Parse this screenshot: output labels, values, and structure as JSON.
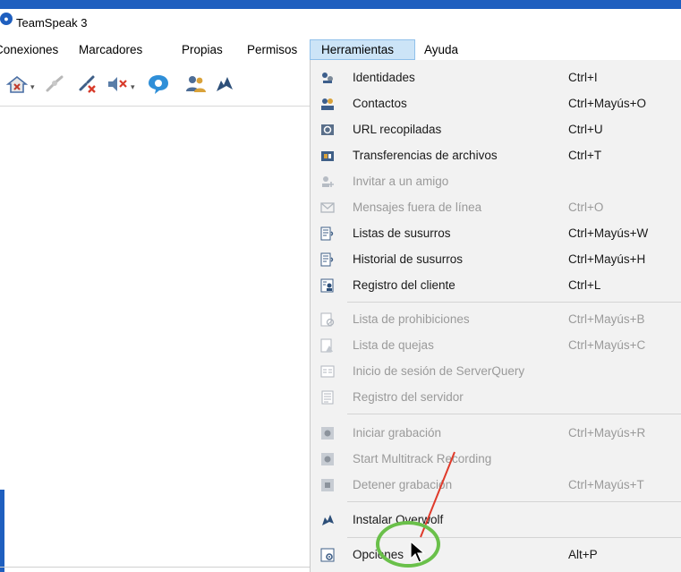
{
  "window": {
    "title": "TeamSpeak 3"
  },
  "menubar": {
    "items": [
      {
        "label": "Conexiones"
      },
      {
        "label": "Marcadores"
      },
      {
        "label": "Propias"
      },
      {
        "label": "Permisos"
      },
      {
        "label": "Herramientas"
      },
      {
        "label": "Ayuda"
      }
    ],
    "open_menu": "Herramientas"
  },
  "toolbar": {
    "icons": [
      "away-icon",
      "connect-icon",
      "disconnect-icon",
      "mute-speakers-icon",
      "chat-icon",
      "contacts-icon",
      "overwolf-icon"
    ]
  },
  "tools_menu": {
    "items": [
      {
        "label": "Identidades",
        "shortcut": "Ctrl+I",
        "enabled": true,
        "icon": "identities-icon"
      },
      {
        "label": "Contactos",
        "shortcut": "Ctrl+Mayús+O",
        "enabled": true,
        "icon": "contacts-icon"
      },
      {
        "label": "URL recopiladas",
        "shortcut": "Ctrl+U",
        "enabled": true,
        "icon": "url-icon"
      },
      {
        "label": "Transferencias de archivos",
        "shortcut": "Ctrl+T",
        "enabled": true,
        "icon": "file-transfer-icon"
      },
      {
        "label": "Invitar a un amigo",
        "shortcut": "",
        "enabled": false,
        "icon": "invite-friend-icon"
      },
      {
        "label": "Mensajes fuera de línea",
        "shortcut": "Ctrl+O",
        "enabled": false,
        "icon": "offline-messages-icon"
      },
      {
        "label": "Listas de susurros",
        "shortcut": "Ctrl+Mayús+W",
        "enabled": true,
        "icon": "whisper-list-icon"
      },
      {
        "label": "Historial de susurros",
        "shortcut": "Ctrl+Mayús+H",
        "enabled": true,
        "icon": "whisper-history-icon"
      },
      {
        "label": "Registro del cliente",
        "shortcut": "Ctrl+L",
        "enabled": true,
        "icon": "client-log-icon"
      },
      {
        "label": "Lista de prohibiciones",
        "shortcut": "Ctrl+Mayús+B",
        "enabled": false,
        "icon": "ban-list-icon"
      },
      {
        "label": "Lista de quejas",
        "shortcut": "Ctrl+Mayús+C",
        "enabled": false,
        "icon": "complaints-icon"
      },
      {
        "label": "Inicio de sesión de ServerQuery",
        "shortcut": "",
        "enabled": false,
        "icon": "serverquery-login-icon"
      },
      {
        "label": "Registro del servidor",
        "shortcut": "",
        "enabled": false,
        "icon": "server-log-icon"
      },
      {
        "label": "Iniciar grabación",
        "shortcut": "Ctrl+Mayús+R",
        "enabled": false,
        "icon": "record-icon"
      },
      {
        "label": "Start Multitrack Recording",
        "shortcut": "",
        "enabled": false,
        "icon": "multitrack-record-icon"
      },
      {
        "label": "Detener grabación",
        "shortcut": "Ctrl+Mayús+T",
        "enabled": false,
        "icon": "stop-record-icon"
      },
      {
        "label": "Instalar Overwolf",
        "shortcut": "",
        "enabled": true,
        "icon": "overwolf-icon"
      },
      {
        "label": "Opciones",
        "shortcut": "Alt+P",
        "enabled": true,
        "icon": "options-icon"
      }
    ]
  },
  "colors": {
    "accent": "#1f5fbf",
    "menu_highlight": "#cce4f7",
    "annotation_circle": "#6ac04a",
    "annotation_line": "#e03a2a"
  }
}
